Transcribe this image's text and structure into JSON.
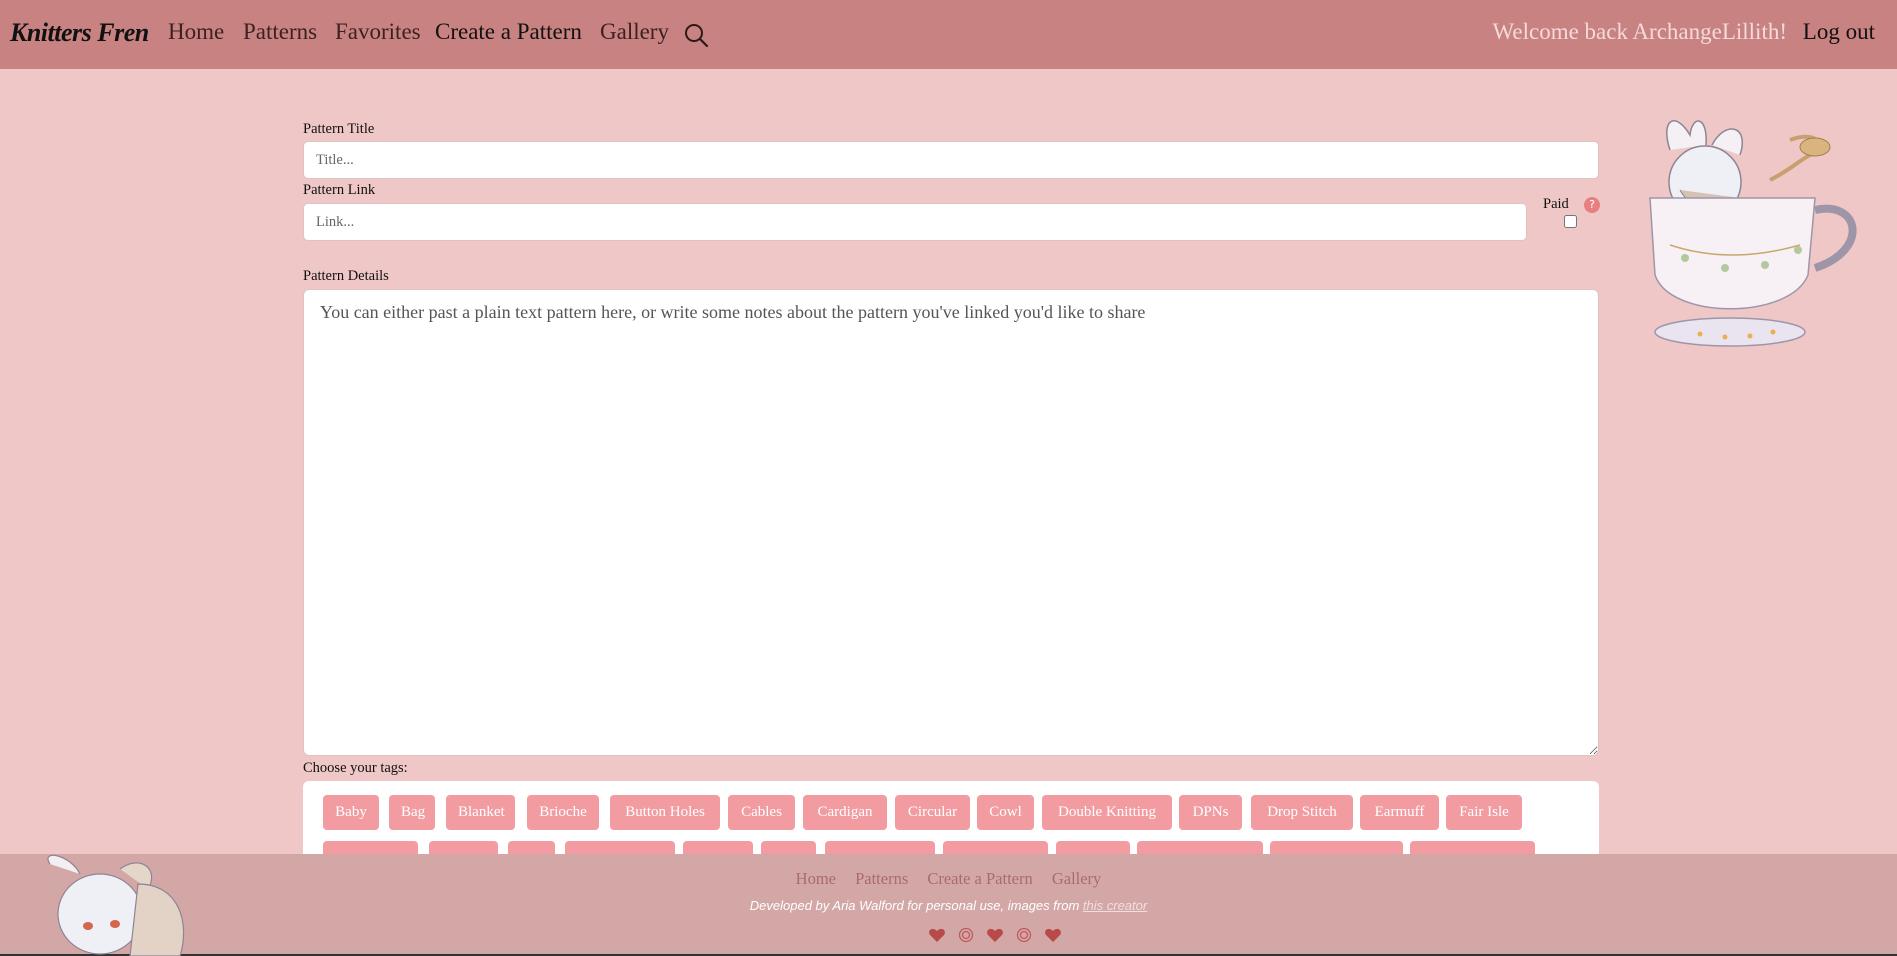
{
  "navbar": {
    "brand": "Knitters Fren",
    "links": [
      "Home",
      "Patterns",
      "Favorites",
      "Create a Pattern",
      "Gallery"
    ],
    "welcome": "Welcome back ArchangeLillith!",
    "logout": "Log out"
  },
  "form": {
    "title_label": "Pattern Title",
    "title_placeholder": "Title...",
    "link_label": "Pattern Link",
    "link_placeholder": "Link...",
    "paid_label": "Paid",
    "help_text": "?",
    "details_label": "Pattern Details",
    "details_placeholder": "You can either past a plain text pattern here, or write some notes about the pattern you've linked you'd like to share",
    "tags_label": "Choose your tags:"
  },
  "tags": [
    "Baby",
    "Bag",
    "Blanket",
    "Brioche",
    "Button Holes",
    "Cables",
    "Cardigan",
    "Circular",
    "Cowl",
    "Double Knitting",
    "DPNs",
    "Drop Stitch",
    "Earmuff",
    "Fair Isle"
  ],
  "footer": {
    "links": [
      "Home",
      "Patterns",
      "Create a Pattern",
      "Gallery"
    ],
    "credit_text": "Developed by Aria Walford for personal use, images from",
    "credit_link": "this creator"
  },
  "colors": {
    "navbar": "#c98282",
    "page_bg": "#efc7c7",
    "tag": "#f29ca2",
    "footer": "#d4a7a7",
    "accent_heart": "#b94a4a"
  },
  "icons": [
    "search-icon",
    "help-icon",
    "heart-icon",
    "yarn-icon"
  ]
}
